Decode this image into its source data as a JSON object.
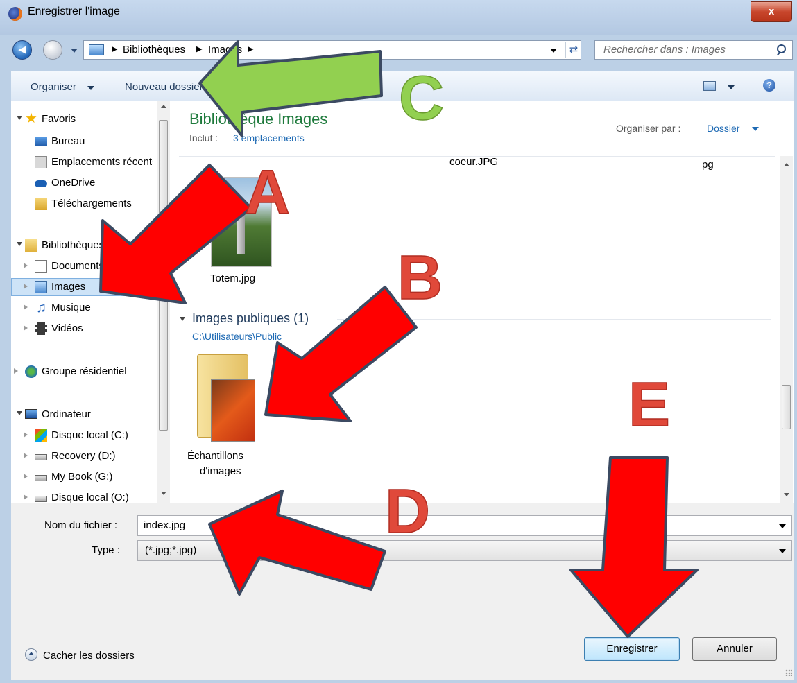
{
  "window": {
    "title": "Enregistrer l'image",
    "close_glyph": "x"
  },
  "address": {
    "crumbs": [
      "Bibliothèques",
      "Images"
    ],
    "search_placeholder": "Rechercher dans : Images"
  },
  "toolbar": {
    "organize": "Organiser",
    "new_folder": "Nouveau dossier"
  },
  "nav": {
    "favorites": "Favoris",
    "desktop": "Bureau",
    "recent": "Emplacements récents",
    "onedrive": "OneDrive",
    "downloads": "Téléchargements",
    "libraries": "Bibliothèques",
    "documents": "Documents",
    "images": "Images",
    "music": "Musique",
    "videos": "Vidéos",
    "homegroup": "Groupe résidentiel",
    "computer": "Ordinateur",
    "drive_c": "Disque local (C:)",
    "drive_d": "Recovery (D:)",
    "drive_g": "My Book (G:)",
    "drive_o": "Disque local (O:)"
  },
  "content": {
    "library_title": "Bibliothèque Images",
    "includes_label": "Inclut :",
    "includes_link": "3 emplacements",
    "arrange_label": "Organiser par :",
    "arrange_value": "Dossier",
    "file_top": "coeur.JPG",
    "file_top_right": "pg",
    "file_totem": "Totem.jpg",
    "group_title": "Images publiques (1)",
    "group_path": "C:\\Utilisateurs\\Public",
    "folder_line1": "Échantillons",
    "folder_line2": "d'images"
  },
  "form": {
    "filename_label": "Nom du fichier :",
    "filename_value": "index.jpg",
    "type_label": "Type :",
    "type_value": "(*.jpg;*.jpg)"
  },
  "buttons": {
    "hide_folders": "Cacher les dossiers",
    "save": "Enregistrer",
    "cancel": "Annuler"
  },
  "annotations": {
    "a": "A",
    "b": "B",
    "c": "C",
    "d": "D",
    "e": "E"
  },
  "colors": {
    "arrow_red": "#ff0000",
    "arrow_green": "#92d050",
    "letter_red": "#e0493a",
    "link_blue": "#1e6ab4",
    "title_green": "#1e7a3c"
  }
}
